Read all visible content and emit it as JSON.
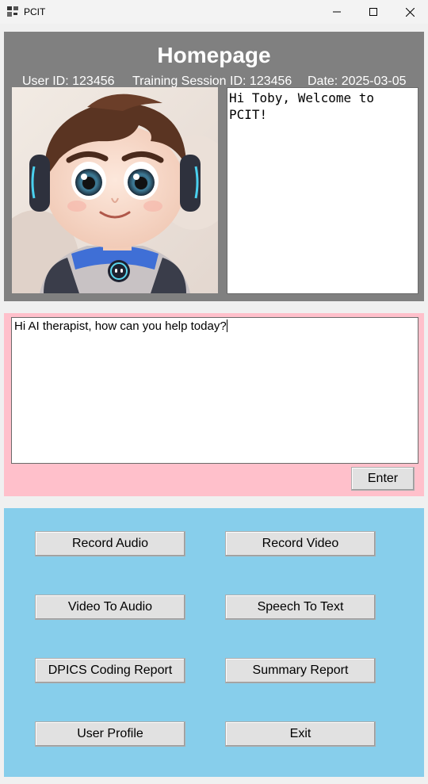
{
  "window": {
    "title": "PCIT"
  },
  "header": {
    "title": "Homepage",
    "user_id": "User ID: 123456",
    "session_id": "Training Session ID: 123456",
    "date": "Date: 2025-03-05"
  },
  "avatar": {
    "icon": "robot-boy-avatar"
  },
  "welcome": {
    "text": "Hi Toby, Welcome to PCIT!"
  },
  "chat": {
    "input_value": "Hi AI therapist, how can you help today?",
    "enter_label": "Enter"
  },
  "actions": {
    "record_audio": "Record Audio",
    "record_video": "Record Video",
    "video_to_audio": "Video To Audio",
    "speech_to_text": "Speech To Text",
    "dpics_report": "DPICS Coding Report",
    "summary_report": "Summary Report",
    "user_profile": "User Profile",
    "exit": "Exit"
  },
  "colors": {
    "header_bg": "#808080",
    "input_panel_bg": "#ffc0cb",
    "action_panel_bg": "#87ceeb",
    "button_bg": "#e1e1e1"
  }
}
